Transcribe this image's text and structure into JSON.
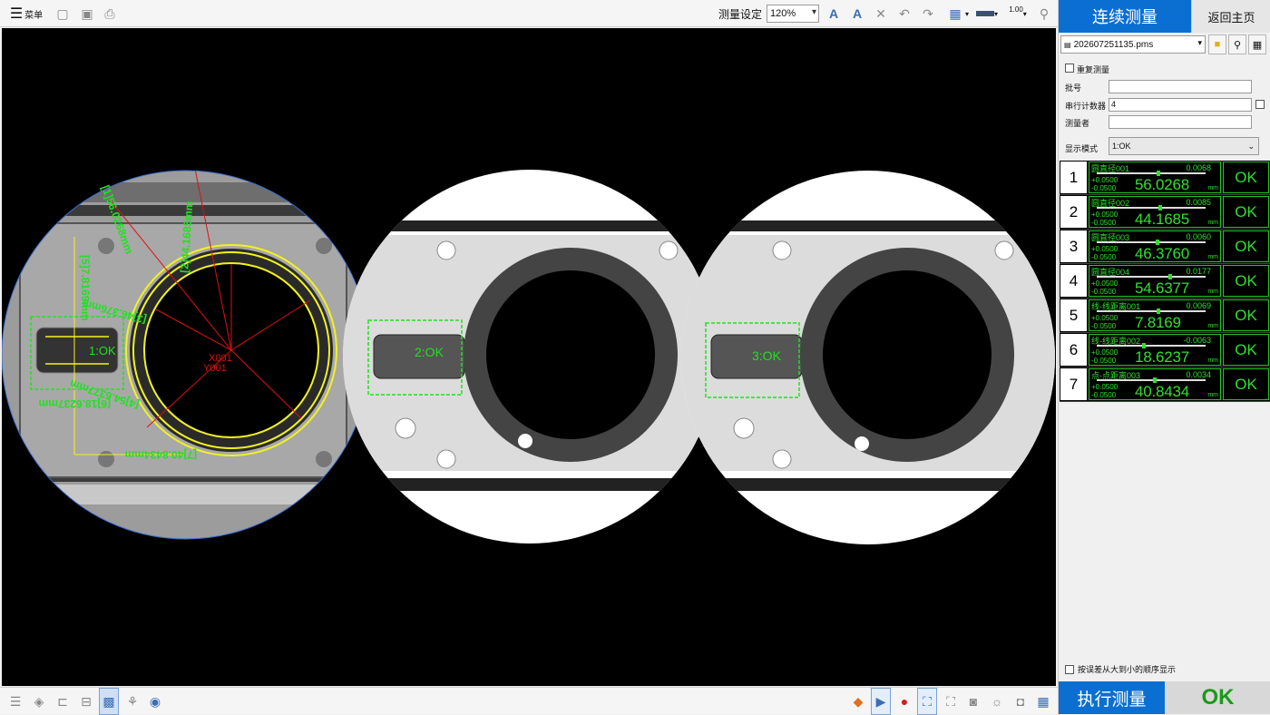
{
  "toolbar": {
    "menu_label": "菜单",
    "measure_setting_label": "测量设定",
    "zoom_value": "120%",
    "line_width_value": "1.00"
  },
  "viewport": {
    "stations": [
      {
        "label": "1:OK"
      },
      {
        "label": "2:OK"
      },
      {
        "label": "3:OK"
      }
    ],
    "annotations": [
      "[2]44.1685mm",
      "[1]56.0268mm",
      "[3]46.376mm",
      "[4]54.6377mm",
      "[5]7.8169mm",
      "[6]18.6237mm",
      "[7]40.8434mm"
    ],
    "axis_x_label": "X001",
    "axis_y_label": "Y001"
  },
  "side": {
    "continuous_button": "连续测量",
    "home_button": "返回主页",
    "file_name": "202607251135.pms",
    "repeat_label": "重复测量",
    "batch_label": "批号",
    "batch_value": "",
    "counter_label": "串行计数器",
    "counter_value": "4",
    "operator_label": "测量者",
    "operator_value": "",
    "display_mode_label": "显示模式",
    "display_mode_value": "1:OK",
    "sort_label": "按误差从大到小的顺序显示",
    "execute_button": "执行测量",
    "overall_result": "OK"
  },
  "results": [
    {
      "num": "1",
      "name": "圆直径001",
      "dev": "0.0068",
      "tol_plus": "+0.0500",
      "tol_minus": "-0.0500",
      "value": "56.0268",
      "unit": "mm",
      "status": "OK",
      "pos": 0.568
    },
    {
      "num": "2",
      "name": "圆直径002",
      "dev": "0.0085",
      "tol_plus": "+0.0500",
      "tol_minus": "-0.0500",
      "value": "44.1685",
      "unit": "mm",
      "status": "OK",
      "pos": 0.585
    },
    {
      "num": "3",
      "name": "圆直径003",
      "dev": "0.0060",
      "tol_plus": "+0.0500",
      "tol_minus": "-0.0500",
      "value": "46.3760",
      "unit": "mm",
      "status": "OK",
      "pos": 0.56
    },
    {
      "num": "4",
      "name": "圆直径004",
      "dev": "0.0177",
      "tol_plus": "+0.0500",
      "tol_minus": "-0.0500",
      "value": "54.6377",
      "unit": "mm",
      "status": "OK",
      "pos": 0.677
    },
    {
      "num": "5",
      "name": "线-线距离001",
      "dev": "0.0069",
      "tol_plus": "+0.0500",
      "tol_minus": "-0.0500",
      "value": "7.8169",
      "unit": "mm",
      "status": "OK",
      "pos": 0.569
    },
    {
      "num": "6",
      "name": "线-线距离002",
      "dev": "-0.0063",
      "tol_plus": "+0.0500",
      "tol_minus": "-0.0500",
      "value": "18.6237",
      "unit": "mm",
      "status": "OK",
      "pos": 0.437
    },
    {
      "num": "7",
      "name": "点-点距离003",
      "dev": "0.0034",
      "tol_plus": "+0.0500",
      "tol_minus": "-0.0500",
      "value": "40.8434",
      "unit": "mm",
      "status": "OK",
      "pos": 0.534
    }
  ]
}
